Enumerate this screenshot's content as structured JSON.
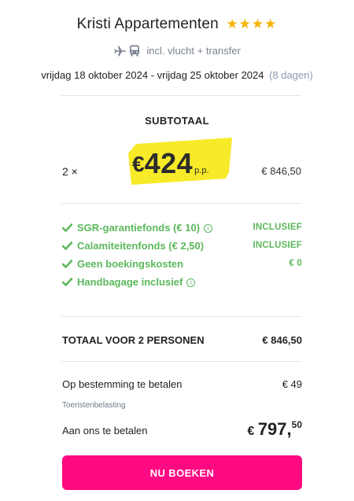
{
  "header": {
    "title": "Kristi Appartementen",
    "stars": "★★★★",
    "transport_text": "incl. vlucht + transfer",
    "dates": "vrijdag 18 oktober 2024 - vrijdag 25 oktober 2024",
    "days": "(8 dagen)"
  },
  "price": {
    "subtotal_label": "SUBTOTAAL",
    "quantity": "2 ×",
    "currency": "€",
    "amount": "424",
    "per_person": "p.p.",
    "row_total": "€ 846,50"
  },
  "inclusions": [
    {
      "label": "SGR-garantiefonds  (€ 10)",
      "info": "i",
      "value": "INCLUSIEF"
    },
    {
      "label": "Calamiteitenfonds  (€ 2,50)",
      "info": "",
      "value": "INCLUSIEF"
    },
    {
      "label": "Geen boekingskosten",
      "info": "",
      "value": "€ 0"
    },
    {
      "label": "Handbagage inclusief",
      "info": "i",
      "value": ""
    }
  ],
  "total": {
    "label": "TOTAAL VOOR 2 PERSONEN",
    "amount": "€ 846,50"
  },
  "destination": {
    "label": "Op bestemming te betalen",
    "amount": "€ 49",
    "sub_label": "Toeristenbelasting"
  },
  "pay": {
    "label": "Aan ons te betalen",
    "currency": "€",
    "whole": "797,",
    "cents": "50"
  },
  "cta": {
    "label": "NU BOEKEN"
  },
  "colors": {
    "accent": "#ff0a82",
    "included_green": "#5cb85c",
    "highlight_yellow": "#f7ea28",
    "star_gold": "#f5b400",
    "muted": "#8a9aae"
  },
  "icons": {
    "transport": [
      "plane-icon",
      "bus-icon"
    ],
    "check": "check-icon",
    "info": "info-icon"
  }
}
